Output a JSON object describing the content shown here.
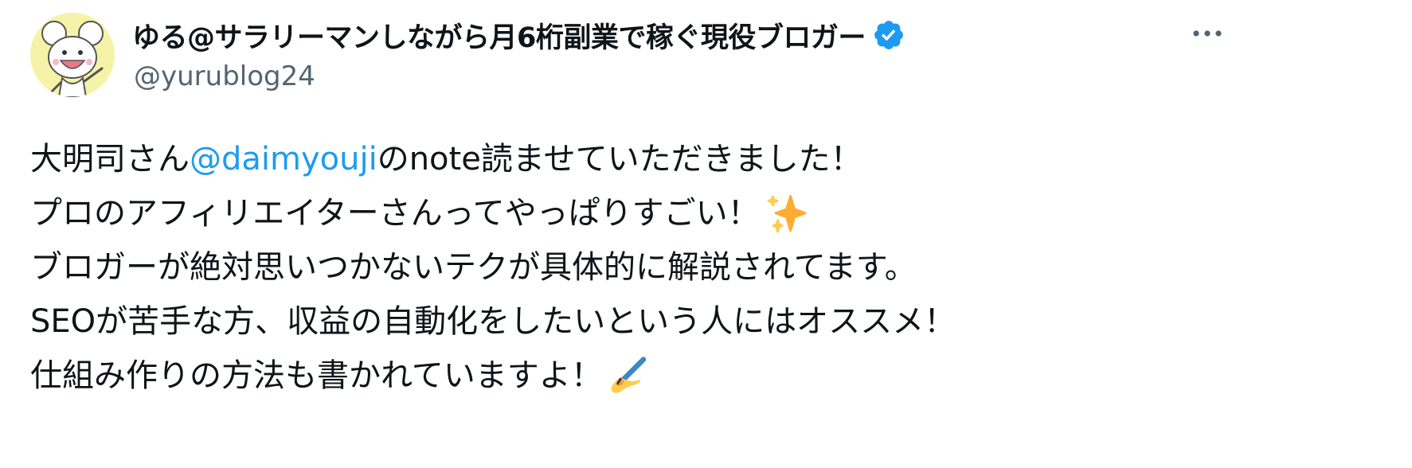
{
  "author": {
    "display_name": "ゆる@サラリーマンしながら月6桁副業で稼ぐ現役ブロガー",
    "handle": "@yurublog24",
    "verified": true
  },
  "tweet": {
    "line1_before": "大明司さん",
    "line1_mention": "@daimyouji",
    "line1_after": "のnote読ませていただきました！",
    "line2": "プロのアフィリエイターさんってやっぱりすごい！",
    "line2_emoji": "sparkles-icon",
    "line3": "ブロガーが絶対思いつかないテクが具体的に解説されてます。",
    "line4": "SEOが苦手な方、収益の自動化をしたいという人にはオススメ！",
    "line5": "仕組み作りの方法も書かれていますよ！",
    "line5_emoji": "writing-hand-icon"
  },
  "icons": {
    "avatar": "cartoon-mouse-avatar",
    "verified": "verified-badge-icon",
    "more": "more-options-icon"
  },
  "colors": {
    "mention": "#1d9bf0",
    "verified": "#1d9bf0",
    "handle": "#536471",
    "text": "#0f1419",
    "avatar_bg": "#f5f3a8"
  }
}
